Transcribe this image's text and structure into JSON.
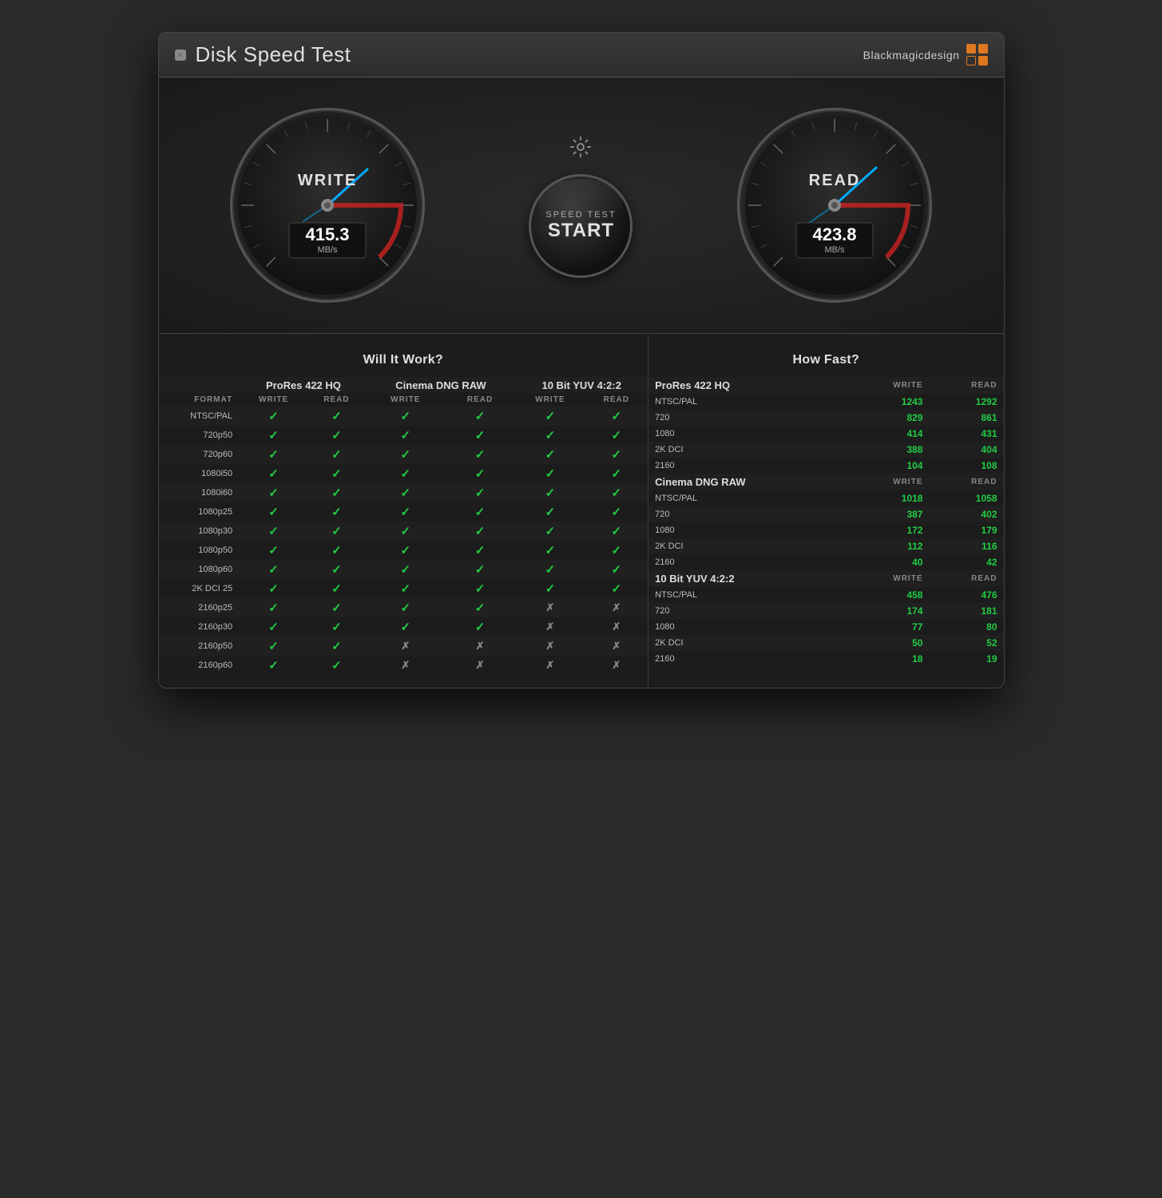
{
  "app": {
    "title": "Disk Speed Test",
    "close_label": "×",
    "brand_name": "Blackmagicdesign"
  },
  "gauges": {
    "write": {
      "label": "WRITE",
      "value": "415.3",
      "unit": "MB/s"
    },
    "read": {
      "label": "READ",
      "value": "423.8",
      "unit": "MB/s"
    }
  },
  "start_button": {
    "top": "SPEED TEST",
    "main": "START"
  },
  "will_it_work": {
    "title": "Will It Work?",
    "col_groups": [
      "ProRes 422 HQ",
      "Cinema DNG RAW",
      "10 Bit YUV 4:2:2"
    ],
    "format_header": "FORMAT",
    "sub_headers": [
      "WRITE",
      "READ"
    ],
    "rows": [
      {
        "label": "NTSC/PAL",
        "prores": [
          true,
          true
        ],
        "dng": [
          true,
          true
        ],
        "yuv": [
          true,
          true
        ]
      },
      {
        "label": "720p50",
        "prores": [
          true,
          true
        ],
        "dng": [
          true,
          true
        ],
        "yuv": [
          true,
          true
        ]
      },
      {
        "label": "720p60",
        "prores": [
          true,
          true
        ],
        "dng": [
          true,
          true
        ],
        "yuv": [
          true,
          true
        ]
      },
      {
        "label": "1080i50",
        "prores": [
          true,
          true
        ],
        "dng": [
          true,
          true
        ],
        "yuv": [
          true,
          true
        ]
      },
      {
        "label": "1080i60",
        "prores": [
          true,
          true
        ],
        "dng": [
          true,
          true
        ],
        "yuv": [
          true,
          true
        ]
      },
      {
        "label": "1080p25",
        "prores": [
          true,
          true
        ],
        "dng": [
          true,
          true
        ],
        "yuv": [
          true,
          true
        ]
      },
      {
        "label": "1080p30",
        "prores": [
          true,
          true
        ],
        "dng": [
          true,
          true
        ],
        "yuv": [
          true,
          true
        ]
      },
      {
        "label": "1080p50",
        "prores": [
          true,
          true
        ],
        "dng": [
          true,
          true
        ],
        "yuv": [
          true,
          true
        ]
      },
      {
        "label": "1080p60",
        "prores": [
          true,
          true
        ],
        "dng": [
          true,
          true
        ],
        "yuv": [
          true,
          true
        ]
      },
      {
        "label": "2K DCI 25",
        "prores": [
          true,
          true
        ],
        "dng": [
          true,
          true
        ],
        "yuv": [
          true,
          true
        ]
      },
      {
        "label": "2160p25",
        "prores": [
          true,
          true
        ],
        "dng": [
          true,
          true
        ],
        "yuv": [
          false,
          false
        ]
      },
      {
        "label": "2160p30",
        "prores": [
          true,
          true
        ],
        "dng": [
          true,
          true
        ],
        "yuv": [
          false,
          false
        ]
      },
      {
        "label": "2160p50",
        "prores": [
          true,
          true
        ],
        "dng": [
          false,
          false
        ],
        "yuv": [
          false,
          false
        ]
      },
      {
        "label": "2160p60",
        "prores": [
          true,
          true
        ],
        "dng": [
          false,
          false
        ],
        "yuv": [
          false,
          false
        ]
      }
    ]
  },
  "how_fast": {
    "title": "How Fast?",
    "sections": [
      {
        "group": "ProRes 422 HQ",
        "rows": [
          {
            "label": "NTSC/PAL",
            "write": 1243,
            "read": 1292
          },
          {
            "label": "720",
            "write": 829,
            "read": 861
          },
          {
            "label": "1080",
            "write": 414,
            "read": 431
          },
          {
            "label": "2K DCI",
            "write": 388,
            "read": 404
          },
          {
            "label": "2160",
            "write": 104,
            "read": 108
          }
        ]
      },
      {
        "group": "Cinema DNG RAW",
        "rows": [
          {
            "label": "NTSC/PAL",
            "write": 1018,
            "read": 1058
          },
          {
            "label": "720",
            "write": 387,
            "read": 402
          },
          {
            "label": "1080",
            "write": 172,
            "read": 179
          },
          {
            "label": "2K DCI",
            "write": 112,
            "read": 116
          },
          {
            "label": "2160",
            "write": 40,
            "read": 42
          }
        ]
      },
      {
        "group": "10 Bit YUV 4:2:2",
        "rows": [
          {
            "label": "NTSC/PAL",
            "write": 458,
            "read": 476
          },
          {
            "label": "720",
            "write": 174,
            "read": 181
          },
          {
            "label": "1080",
            "write": 77,
            "read": 80
          },
          {
            "label": "2K DCI",
            "write": 50,
            "read": 52
          },
          {
            "label": "2160",
            "write": 18,
            "read": 19
          }
        ]
      }
    ]
  },
  "colors": {
    "accent_orange": "#e07820",
    "check_green": "#22cc44",
    "gauge_needle": "#00aaff",
    "gauge_red_zone": "#cc2222"
  }
}
